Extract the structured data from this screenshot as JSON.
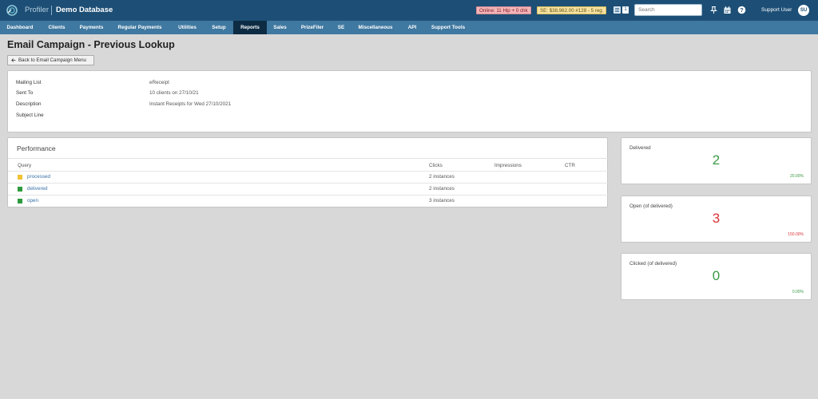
{
  "header": {
    "brand": "Profiler",
    "database": "Demo Database",
    "online_badge": "Online: 11 Hip + 0 chk",
    "se_badge": "SE: $38,962.00 #128 - 5 reg.",
    "toggle_count": "1",
    "search_placeholder": "Search",
    "user_name": "Support User",
    "user_initials": "SU"
  },
  "nav": {
    "items": [
      "Dashboard",
      "Clients",
      "Payments",
      "Regular Payments",
      "Utilities",
      "Setup",
      "Reports",
      "Sales",
      "PrizeFiler",
      "SE",
      "Miscellaneous",
      "API",
      "Support Tools"
    ],
    "active": "Reports"
  },
  "page": {
    "title": "Email Campaign - Previous Lookup",
    "back_label": "Back to Email Campaign Menu"
  },
  "details": [
    {
      "label": "Mailing List",
      "value": "eReceipt"
    },
    {
      "label": "Sent To",
      "value": "10 clients on 27/10/21"
    },
    {
      "label": "Description",
      "value": "Instant Receipts for Wed 27/10/2021"
    },
    {
      "label": "Subject Line",
      "value": ""
    }
  ],
  "performance": {
    "title": "Performance",
    "columns": [
      "Query",
      "Clicks",
      "Impressions",
      "CTR"
    ],
    "rows": [
      {
        "query": "processed",
        "clicks": "2 instances",
        "status_color": "#f1c232"
      },
      {
        "query": "delivered",
        "clicks": "2 instances",
        "status_color": "#2e9a3c"
      },
      {
        "query": "open",
        "clicks": "3 instances",
        "status_color": "#2e9a3c"
      }
    ]
  },
  "stats": [
    {
      "label": "Delivered",
      "value": "2",
      "percent": "20.00%",
      "color": "#3a9a45"
    },
    {
      "label": "Open (of delivered)",
      "value": "3",
      "percent": "150.00%",
      "color": "#d9343a"
    },
    {
      "label": "Clicked (of delivered)",
      "value": "0",
      "percent": "0.00%",
      "color": "#3a9a45"
    }
  ],
  "icons": [
    "profiler-logo-icon",
    "list-toggle-icon",
    "pin-icon",
    "calendar-icon",
    "help-icon",
    "arrow-left-icon"
  ]
}
